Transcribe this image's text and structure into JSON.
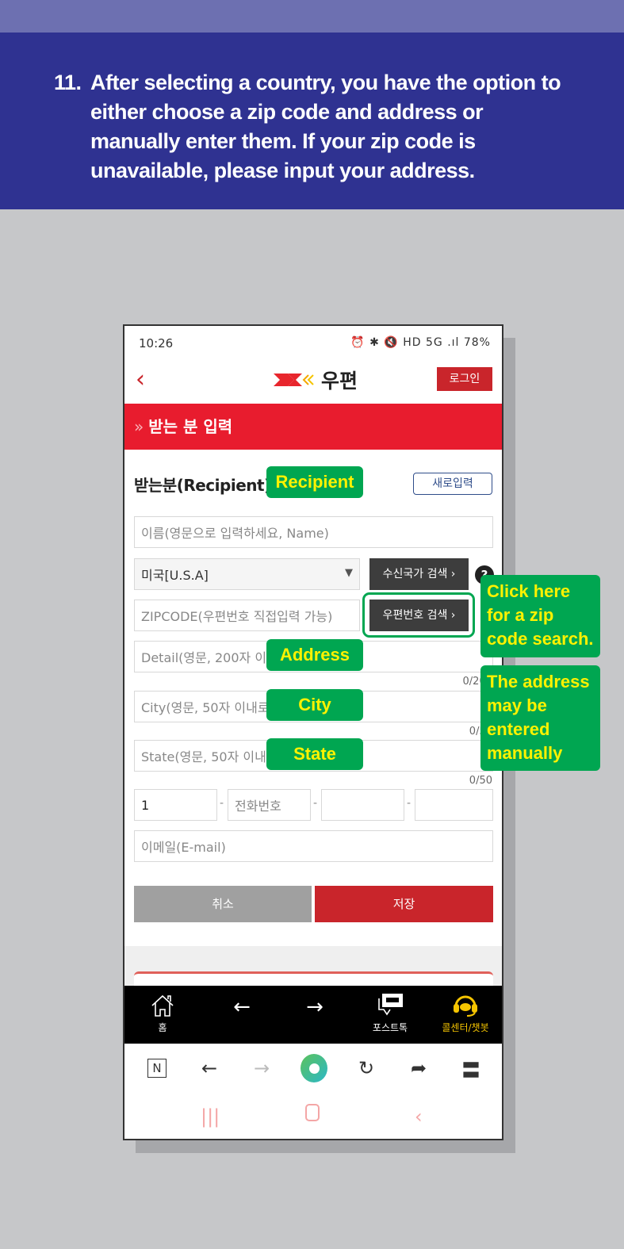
{
  "instruction": {
    "number": "11.",
    "text": "After selecting a country, you have the option to either choose a zip code and address or manually enter them. If your zip code is unavailable, please input your address."
  },
  "status_bar": {
    "time": "10:26",
    "right": "⏰ ✱ 🔇 HD 5G .ıl 78%",
    "battery": "78%"
  },
  "app_bar": {
    "back_icon": "chevron-left-icon",
    "logo_text": "우편",
    "login_label": "로그인"
  },
  "section": {
    "chevron": "»",
    "title": "받는 분 입력"
  },
  "recipient": {
    "title": "받는분(Recipient)",
    "new_input_label": "새로입력",
    "name_placeholder": "이름(영문으로 입력하세요, Name)",
    "country_value": "미국[U.S.A]",
    "country_search_label": "수신국가 검색 ›",
    "help_label": "?",
    "zip_placeholder": "ZIPCODE(우편번호 직접입력 가능)",
    "zip_search_label": "우편번호 검색 ›",
    "detail_placeholder": "Detail(영문, 200자 이내로 입력)",
    "detail_counter": "0/200",
    "city_placeholder": "City(영문, 50자 이내로 입력)",
    "city_counter": "0/50",
    "state_placeholder": "State(영문, 50자 이내로 입력)",
    "state_counter": "0/50",
    "phone_country_code": "1",
    "phone_placeholder": "전화번호",
    "phone_sep": "-",
    "email_placeholder": "이메일(E-mail)",
    "cancel_label": "취소",
    "save_label": "저장"
  },
  "bottom_nav": {
    "items": [
      {
        "icon": "home-icon",
        "label": "홈"
      },
      {
        "icon": "arrow-left-icon",
        "label": ""
      },
      {
        "icon": "arrow-right-icon",
        "label": ""
      },
      {
        "icon": "chat-icon",
        "label": "포스트톡"
      },
      {
        "icon": "headset-icon",
        "label": "콜센터/챗봇"
      }
    ],
    "accent": "#f5c400"
  },
  "browser_bar": [
    "n-icon",
    "back-icon",
    "forward-icon",
    "whale-icon",
    "refresh-icon",
    "share-icon",
    "menu-icon"
  ],
  "annotations": {
    "recipient": "Recipient",
    "address": "Address",
    "city": "City",
    "state": "State",
    "zip_note": "Click here for a zip code search.",
    "manual_note": "The address may be entered manually"
  },
  "colors": {
    "header_band": "#2f3291",
    "top_strip": "#6d70b1",
    "brand_red": "#e81c2e",
    "callout_green": "#00a651",
    "callout_text": "#fff200"
  }
}
